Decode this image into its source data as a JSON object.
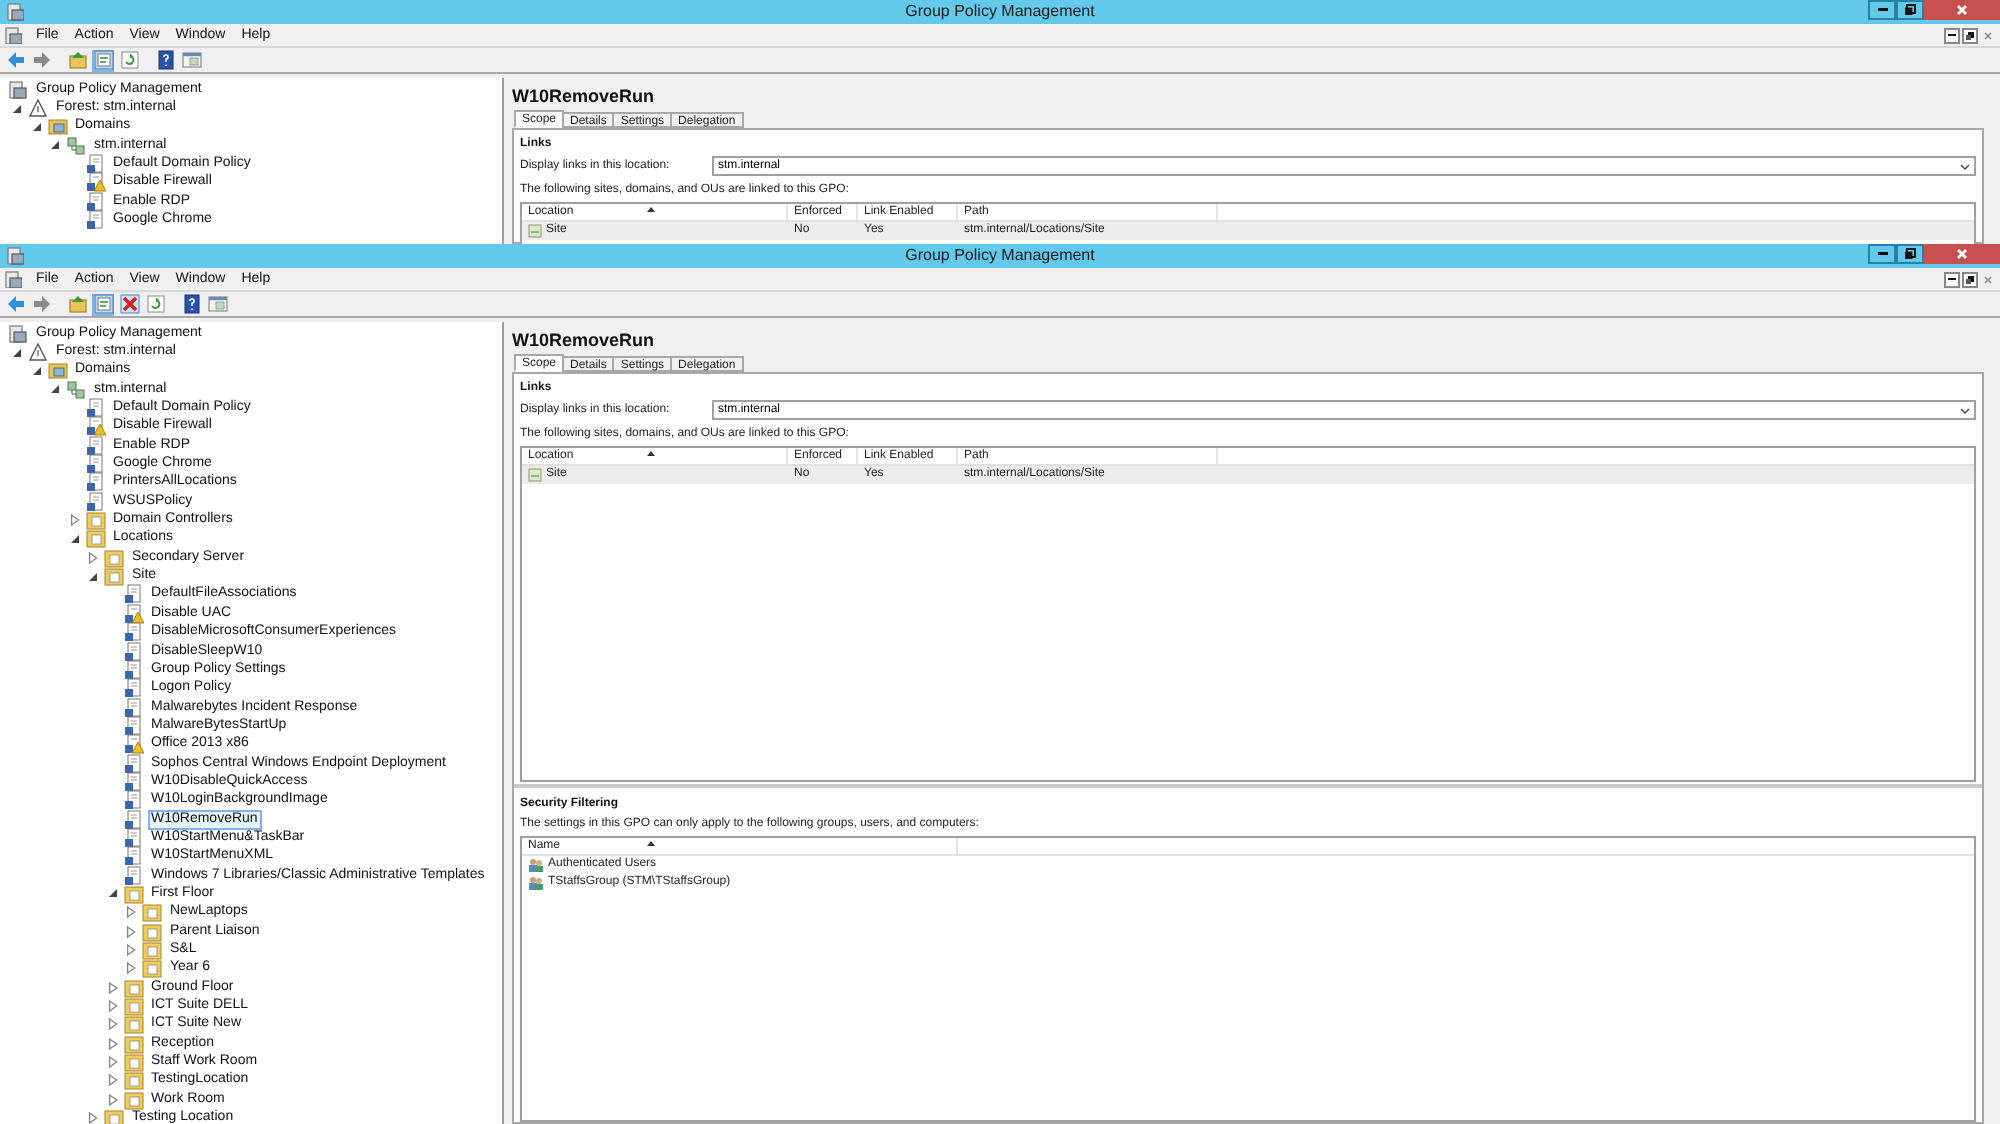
{
  "windows": [
    {
      "title": "Group Policy Management",
      "menu": [
        "File",
        "Action",
        "View",
        "Window",
        "Help"
      ],
      "toolbar": [
        {
          "kind": "back",
          "disabled": false
        },
        {
          "kind": "forward",
          "disabled": true
        },
        {
          "kind": "up"
        },
        {
          "kind": "tree"
        },
        {
          "kind": "refresh"
        },
        {
          "kind": "help"
        },
        {
          "kind": "console"
        }
      ],
      "tree": [
        {
          "label": "Group Policy Management",
          "kind": "root",
          "selected": false,
          "children": [
            {
              "label": "Forest: stm.internal",
              "kind": "forest",
              "expanded": true,
              "selected": false,
              "children": [
                {
                  "label": "Domains",
                  "kind": "domains",
                  "expanded": true,
                  "selected": false,
                  "children": [
                    {
                      "label": "stm.internal",
                      "kind": "domain",
                      "expanded": true,
                      "selected": false,
                      "children": [
                        {
                          "label": "Default Domain Policy",
                          "kind": "gpo",
                          "selected": false
                        },
                        {
                          "label": "Disable Firewall",
                          "kind": "gpo_warn",
                          "selected": false
                        },
                        {
                          "label": "Enable RDP",
                          "kind": "gpo",
                          "selected": false
                        },
                        {
                          "label": "Google Chrome",
                          "kind": "gpo",
                          "selected": false
                        }
                      ]
                    }
                  ]
                }
              ]
            }
          ]
        }
      ],
      "details": {
        "title": "W10RemoveRun",
        "tabs": [
          {
            "label": "Scope",
            "selected": true
          },
          {
            "label": "Details",
            "selected": false
          },
          {
            "label": "Settings",
            "selected": false
          },
          {
            "label": "Delegation",
            "selected": false
          }
        ],
        "links": {
          "heading": "Links",
          "location_label": "Display links in this location:",
          "location_value": "stm.internal",
          "note": "The following sites, domains, and OUs are linked to this GPO:",
          "columns": [
            "Location",
            "Enforced",
            "Link Enabled",
            "Path"
          ],
          "rows": [
            {
              "cells": [
                "Site",
                "No",
                "Yes",
                "stm.internal/Locations/Site"
              ],
              "selected": true
            }
          ]
        }
      }
    },
    {
      "title": "Group Policy Management",
      "menu": [
        "File",
        "Action",
        "View",
        "Window",
        "Help"
      ],
      "toolbar": [
        {
          "kind": "back",
          "disabled": false
        },
        {
          "kind": "forward",
          "disabled": true
        },
        {
          "kind": "up"
        },
        {
          "kind": "tree"
        },
        {
          "kind": "delete"
        },
        {
          "kind": "refresh"
        },
        {
          "kind": "help"
        },
        {
          "kind": "console"
        }
      ],
      "tree": [
        {
          "label": "Group Policy Management",
          "kind": "root",
          "selected": false,
          "children": [
            {
              "label": "Forest: stm.internal",
              "kind": "forest",
              "expanded": true,
              "selected": false,
              "children": [
                {
                  "label": "Domains",
                  "kind": "domains",
                  "expanded": true,
                  "selected": false,
                  "children": [
                    {
                      "label": "stm.internal",
                      "kind": "domain",
                      "expanded": true,
                      "selected": false,
                      "children": [
                        {
                          "label": "Default Domain Policy",
                          "kind": "gpo",
                          "selected": false
                        },
                        {
                          "label": "Disable Firewall",
                          "kind": "gpo_warn",
                          "selected": false
                        },
                        {
                          "label": "Enable RDP",
                          "kind": "gpo",
                          "selected": false
                        },
                        {
                          "label": "Google Chrome",
                          "kind": "gpo",
                          "selected": false
                        },
                        {
                          "label": "PrintersAllLocations",
                          "kind": "gpo",
                          "selected": false
                        },
                        {
                          "label": "WSUSPolicy",
                          "kind": "gpo",
                          "selected": false
                        },
                        {
                          "label": "Domain Controllers",
                          "kind": "ou",
                          "expanded": false,
                          "selected": false
                        },
                        {
                          "label": "Locations",
                          "kind": "ou",
                          "expanded": true,
                          "selected": false,
                          "children": [
                            {
                              "label": "Secondary Server",
                              "kind": "ou",
                              "expanded": false,
                              "selected": false
                            },
                            {
                              "label": "Site",
                              "kind": "ou",
                              "expanded": true,
                              "selected": false,
                              "children": [
                                {
                                  "label": "DefaultFileAssociations",
                                  "kind": "gpo",
                                  "selected": false
                                },
                                {
                                  "label": "Disable UAC",
                                  "kind": "gpo_warn",
                                  "selected": false
                                },
                                {
                                  "label": "DisableMicrosoftConsumerExperiences",
                                  "kind": "gpo",
                                  "selected": false
                                },
                                {
                                  "label": "DisableSleepW10",
                                  "kind": "gpo",
                                  "selected": false
                                },
                                {
                                  "label": "Group Policy Settings",
                                  "kind": "gpo",
                                  "selected": false
                                },
                                {
                                  "label": "Logon Policy",
                                  "kind": "gpo",
                                  "selected": false
                                },
                                {
                                  "label": "Malwarebytes Incident Response",
                                  "kind": "gpo",
                                  "selected": false
                                },
                                {
                                  "label": "MalwareBytesStartUp",
                                  "kind": "gpo",
                                  "selected": false
                                },
                                {
                                  "label": "Office 2013 x86",
                                  "kind": "gpo_warn",
                                  "selected": false
                                },
                                {
                                  "label": "Sophos Central Windows Endpoint Deployment",
                                  "kind": "gpo",
                                  "selected": false
                                },
                                {
                                  "label": "W10DisableQuickAccess",
                                  "kind": "gpo",
                                  "selected": false
                                },
                                {
                                  "label": "W10LoginBackgroundImage",
                                  "kind": "gpo",
                                  "selected": false
                                },
                                {
                                  "label": "W10RemoveRun",
                                  "kind": "gpo",
                                  "selected": true
                                },
                                {
                                  "label": "W10StartMenu&TaskBar",
                                  "kind": "gpo",
                                  "selected": false
                                },
                                {
                                  "label": "W10StartMenuXML",
                                  "kind": "gpo",
                                  "selected": false
                                },
                                {
                                  "label": "Windows 7 Libraries/Classic Administrative Templates",
                                  "kind": "gpo",
                                  "selected": false
                                },
                                {
                                  "label": "First Floor",
                                  "kind": "ou",
                                  "expanded": true,
                                  "selected": false,
                                  "children": [
                                    {
                                      "label": "NewLaptops",
                                      "kind": "ou",
                                      "expanded": false,
                                      "selected": false
                                    },
                                    {
                                      "label": "Parent Liaison",
                                      "kind": "ou",
                                      "expanded": false,
                                      "selected": false
                                    },
                                    {
                                      "label": "S&L",
                                      "kind": "ou",
                                      "expanded": false,
                                      "selected": false
                                    },
                                    {
                                      "label": "Year 6",
                                      "kind": "ou",
                                      "expanded": false,
                                      "selected": false
                                    }
                                  ]
                                },
                                {
                                  "label": "Ground Floor",
                                  "kind": "ou",
                                  "expanded": false,
                                  "selected": false
                                },
                                {
                                  "label": "ICT Suite DELL",
                                  "kind": "ou",
                                  "expanded": false,
                                  "selected": false
                                },
                                {
                                  "label": "ICT Suite New",
                                  "kind": "ou",
                                  "expanded": false,
                                  "selected": false
                                },
                                {
                                  "label": "Reception",
                                  "kind": "ou",
                                  "expanded": false,
                                  "selected": false
                                },
                                {
                                  "label": "Staff Work Room",
                                  "kind": "ou",
                                  "expanded": false,
                                  "selected": false
                                },
                                {
                                  "label": "TestingLocation",
                                  "kind": "ou",
                                  "expanded": false,
                                  "selected": false
                                },
                                {
                                  "label": "Work Room",
                                  "kind": "ou",
                                  "expanded": false,
                                  "selected": false
                                }
                              ]
                            },
                            {
                              "label": "Testing Location",
                              "kind": "ou",
                              "expanded": false,
                              "selected": false
                            }
                          ]
                        }
                      ]
                    }
                  ]
                }
              ]
            }
          ]
        }
      ],
      "details": {
        "title": "W10RemoveRun",
        "tabs": [
          {
            "label": "Scope",
            "selected": true
          },
          {
            "label": "Details",
            "selected": false
          },
          {
            "label": "Settings",
            "selected": false
          },
          {
            "label": "Delegation",
            "selected": false
          }
        ],
        "links": {
          "heading": "Links",
          "location_label": "Display links in this location:",
          "location_value": "stm.internal",
          "note": "The following sites, domains, and OUs are linked to this GPO:",
          "columns": [
            "Location",
            "Enforced",
            "Link Enabled",
            "Path"
          ],
          "rows": [
            {
              "cells": [
                "Site",
                "No",
                "Yes",
                "stm.internal/Locations/Site"
              ],
              "selected": true
            }
          ]
        },
        "security": {
          "heading": "Security Filtering",
          "note": "The settings in this GPO can only apply to the following groups, users, and computers:",
          "columns": [
            "Name"
          ],
          "rows": [
            {
              "cells": [
                "Authenticated Users"
              ],
              "selected": false
            },
            {
              "cells": [
                "TStaffsGroup (STM\\TStaffsGroup)"
              ],
              "selected": false
            }
          ]
        }
      }
    }
  ]
}
